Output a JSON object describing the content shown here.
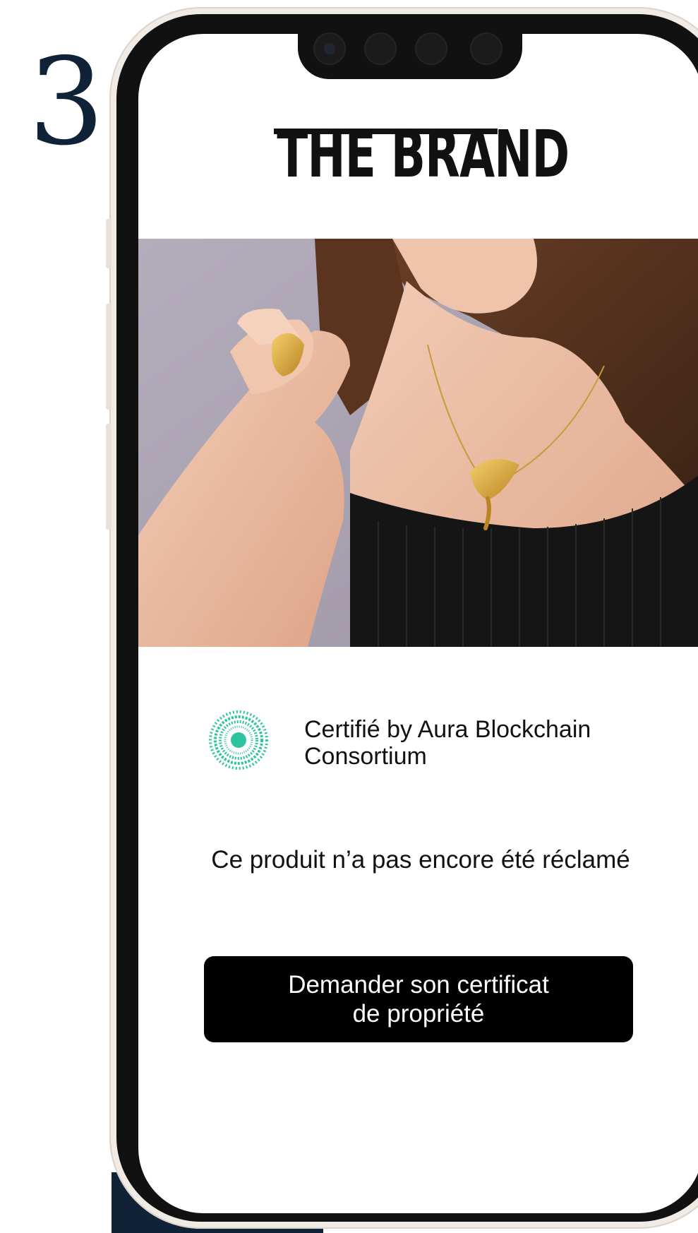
{
  "step": {
    "number": "3"
  },
  "brand": {
    "logo_text": "THE BRAND"
  },
  "hero": {
    "alt": "Woman wearing a gold ginkgo leaf ring and pendant necklace"
  },
  "certification": {
    "label_line1": "Certifié by Aura Blockchain",
    "label_line2": "Consortium",
    "icon": "aura-consortium-seal-icon",
    "icon_color": "#2ec4a0"
  },
  "product": {
    "status": "Ce produit n’a pas encore été réclamé"
  },
  "actions": {
    "claim_label_line1": "Demander son certificat",
    "claim_label_line2": "de propriété"
  },
  "colors": {
    "navy": "#0f2237",
    "button_bg": "#000000",
    "button_text": "#ffffff",
    "phone_bezel": "#111111",
    "phone_shell": "#f1ebe6",
    "accent_teal": "#2ec4a0"
  }
}
